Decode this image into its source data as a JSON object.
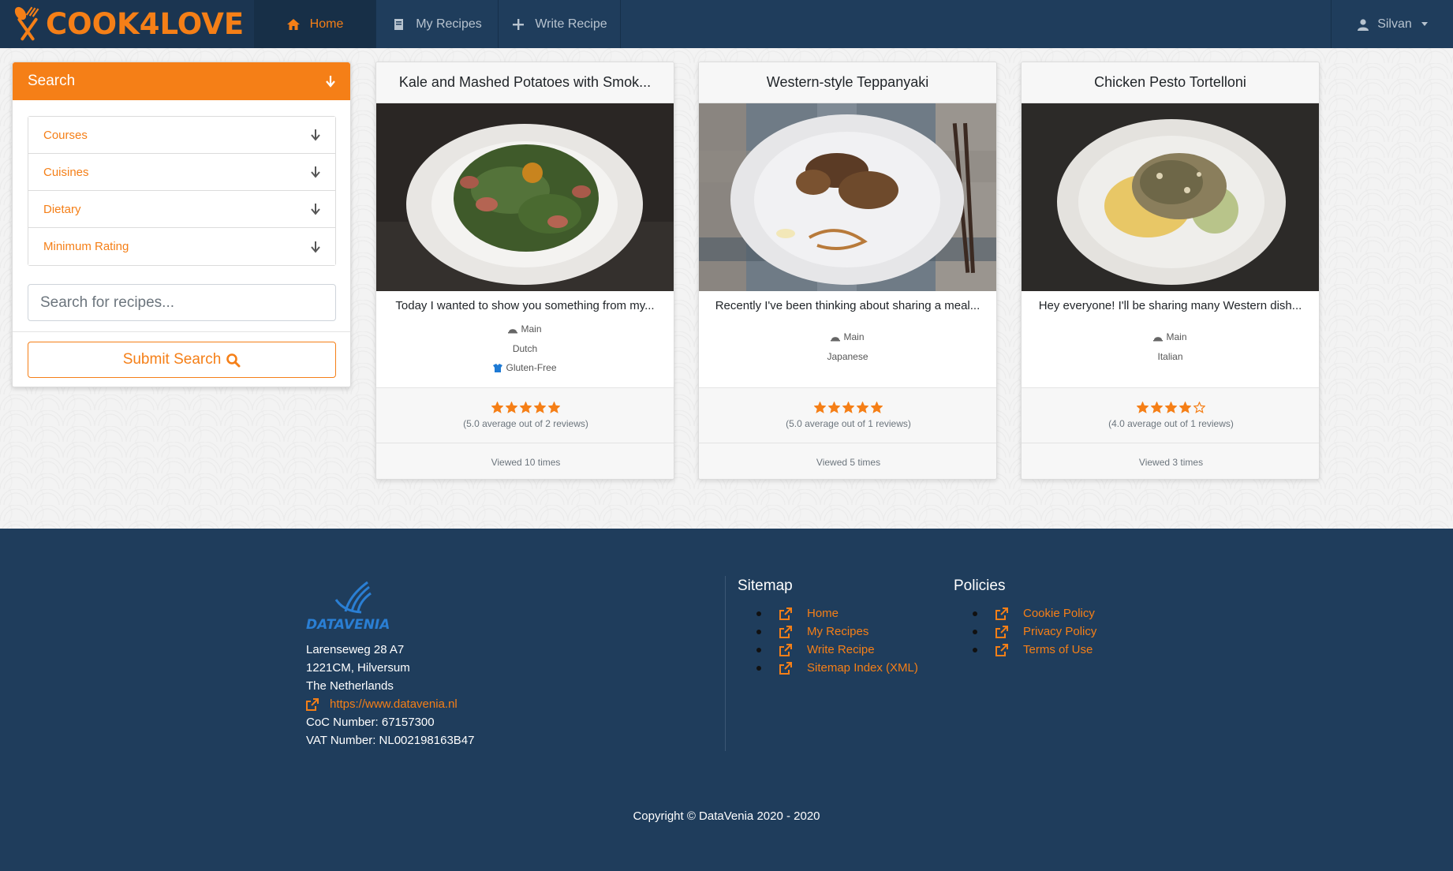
{
  "brand": {
    "name": "COOK4LOVE"
  },
  "nav": {
    "items": [
      {
        "label": "Home",
        "icon": "home-icon",
        "active": true
      },
      {
        "label": "My Recipes",
        "icon": "book-icon",
        "active": false
      },
      {
        "label": "Write Recipe",
        "icon": "plus-icon",
        "active": false
      }
    ],
    "user": {
      "name": "Silvan",
      "icon": "user-icon"
    }
  },
  "search": {
    "header": "Search",
    "filters": [
      {
        "label": "Courses"
      },
      {
        "label": "Cuisines"
      },
      {
        "label": "Dietary"
      },
      {
        "label": "Minimum Rating"
      }
    ],
    "placeholder": "Search for recipes...",
    "submit_label": "Submit Search"
  },
  "recipes": [
    {
      "title": "Kale and Mashed Potatoes with Smok...",
      "description": "Today I wanted to show you something from my...",
      "course": "Main",
      "cuisine": "Dutch",
      "dietary": "Gluten-Free",
      "rating": 5,
      "rating_text": "(5.0 average out of 2 reviews)",
      "views": "Viewed 10 times"
    },
    {
      "title": "Western-style Teppanyaki",
      "description": "Recently I've been thinking about sharing a meal...",
      "course": "Main",
      "cuisine": "Japanese",
      "dietary": "",
      "rating": 5,
      "rating_text": "(5.0 average out of 1 reviews)",
      "views": "Viewed 5 times"
    },
    {
      "title": "Chicken Pesto Tortelloni",
      "description": "Hey everyone! I'll be sharing many Western dish...",
      "course": "Main",
      "cuisine": "Italian",
      "dietary": "",
      "rating": 4,
      "rating_text": "(4.0 average out of 1 reviews)",
      "views": "Viewed 3 times"
    }
  ],
  "footer": {
    "company": {
      "logo_text": "DATAVENIA",
      "address_line1": "Larenseweg 28 A7",
      "address_line2": "1221CM, Hilversum",
      "address_line3": "The Netherlands",
      "website": "https://www.datavenia.nl",
      "coc": "CoC Number: 67157300",
      "vat": "VAT Number: NL002198163B47"
    },
    "sitemap": {
      "title": "Sitemap",
      "links": [
        "Home",
        "My Recipes",
        "Write Recipe",
        "Sitemap Index (XML)"
      ]
    },
    "policies": {
      "title": "Policies",
      "links": [
        "Cookie Policy",
        "Privacy Policy",
        "Terms of Use"
      ]
    },
    "copyright": "Copyright © DataVenia 2020 - 2020"
  },
  "colors": {
    "accent": "#f57f17",
    "navy": "#1f3d5c"
  }
}
